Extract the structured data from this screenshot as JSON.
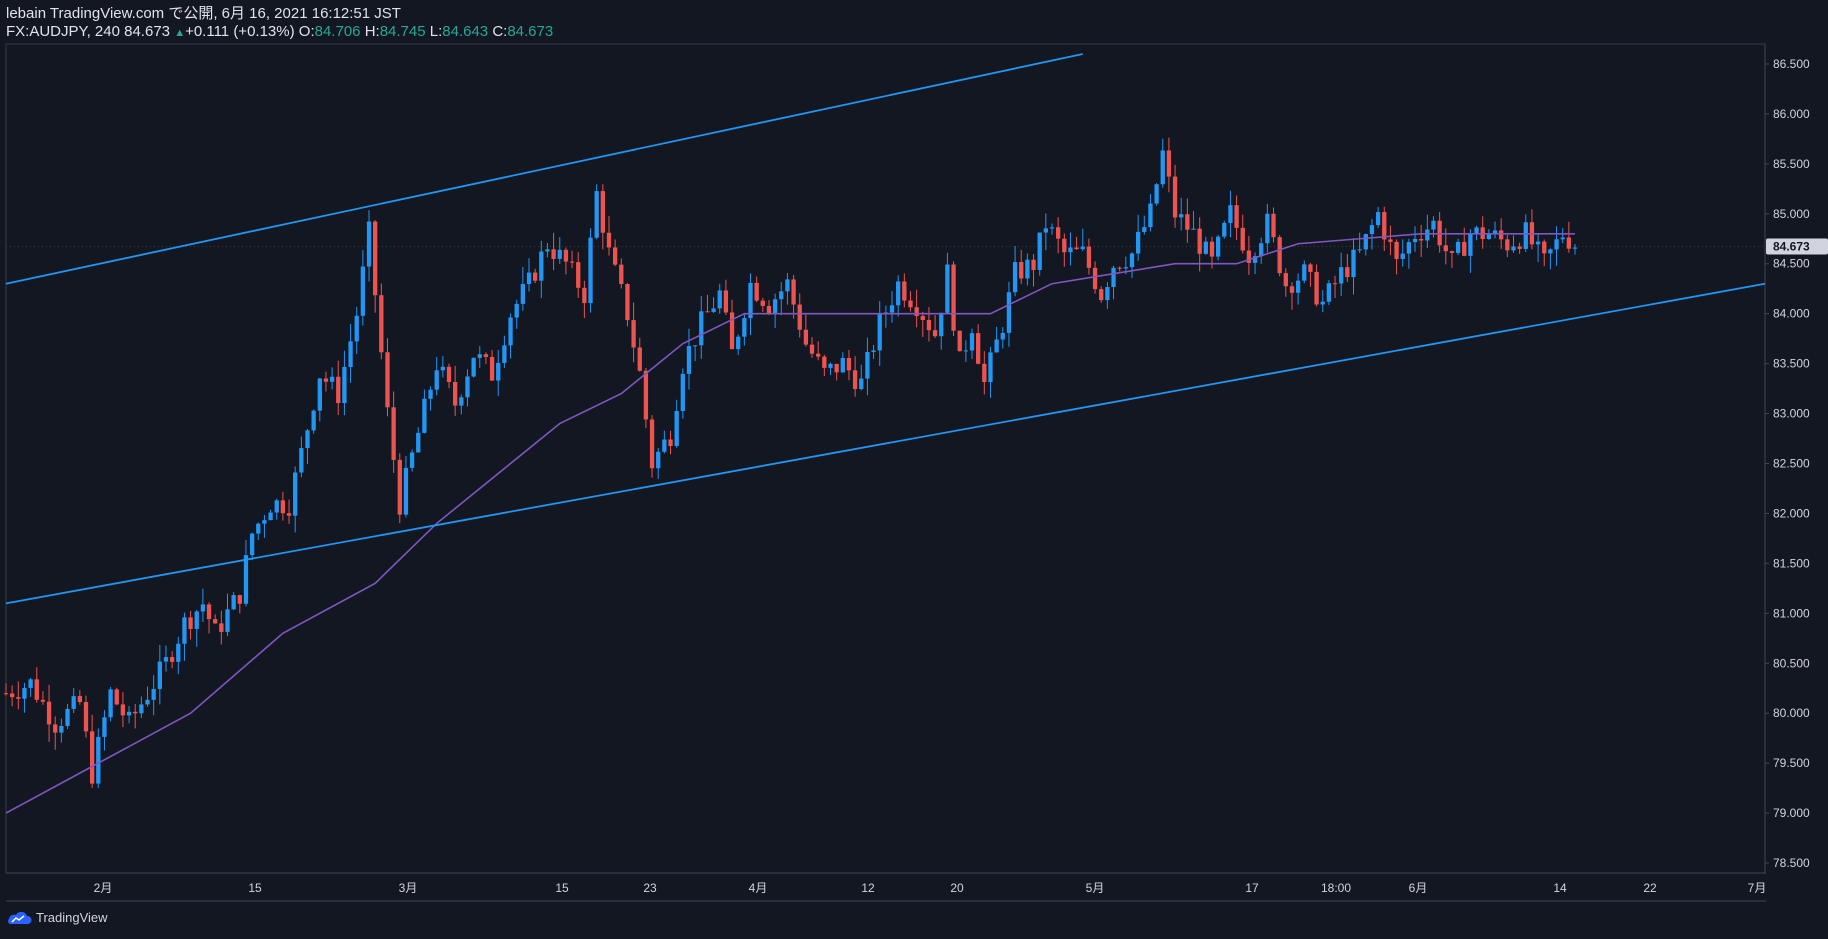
{
  "header": {
    "published_line": "lebain TradingView.com で公開, 6月 16, 2021 16:12:51 JST",
    "symbol": "FX:AUDJPY, 240",
    "last": "84.673",
    "change": "+0.111 (+0.13%)",
    "o_label": "O:",
    "o_value": "84.706",
    "h_label": "H:",
    "h_value": "84.745",
    "l_label": "L:",
    "l_value": "84.643",
    "c_label": "C:",
    "c_value": "84.673"
  },
  "brand": {
    "name": "TradingView"
  },
  "colors": {
    "background": "#131722",
    "up_candle": "#2196f3",
    "down_candle": "#ef5350",
    "moving_average": "#7e57c2",
    "trendline": "#2196f3",
    "last_price_tag": "#d1d4dc"
  },
  "chart_data": {
    "type": "candlestick",
    "title": "FX:AUDJPY, 240",
    "ylim": [
      78.4,
      86.7
    ],
    "y_ticks": [
      "86.500",
      "86.000",
      "85.500",
      "85.000",
      "84.500",
      "84.000",
      "83.500",
      "83.000",
      "82.500",
      "82.000",
      "81.500",
      "81.000",
      "80.500",
      "80.000",
      "79.500",
      "79.000",
      "78.500"
    ],
    "x_ticks": [
      "2月",
      "15",
      "3月",
      "15",
      "23",
      "4月",
      "12",
      "20",
      "5月",
      "17",
      "18:00",
      "6月",
      "14",
      "22",
      "7月"
    ],
    "last_price": "84.673",
    "price_path": [
      [
        0,
        80.2
      ],
      [
        4,
        80.3
      ],
      [
        8,
        79.9
      ],
      [
        12,
        80.1
      ],
      [
        14,
        79.4
      ],
      [
        17,
        80.2
      ],
      [
        20,
        79.9
      ],
      [
        23,
        80.2
      ],
      [
        26,
        80.5
      ],
      [
        29,
        80.9
      ],
      [
        32,
        81.1
      ],
      [
        34,
        80.8
      ],
      [
        38,
        81.2
      ],
      [
        40,
        81.8
      ],
      [
        43,
        82.1
      ],
      [
        46,
        82.1
      ],
      [
        48,
        82.6
      ],
      [
        51,
        83.4
      ],
      [
        54,
        83.2
      ],
      [
        57,
        84.0
      ],
      [
        59,
        84.8
      ],
      [
        60,
        84.2
      ],
      [
        62,
        83.0
      ],
      [
        64,
        82.1
      ],
      [
        67,
        82.8
      ],
      [
        70,
        83.5
      ],
      [
        73,
        83.1
      ],
      [
        76,
        83.6
      ],
      [
        79,
        83.4
      ],
      [
        82,
        84.0
      ],
      [
        85,
        84.3
      ],
      [
        88,
        84.7
      ],
      [
        91,
        84.5
      ],
      [
        94,
        84.2
      ],
      [
        96,
        85.2
      ],
      [
        98,
        84.6
      ],
      [
        101,
        84.0
      ],
      [
        103,
        83.4
      ],
      [
        105,
        82.5
      ],
      [
        108,
        82.8
      ],
      [
        110,
        83.5
      ],
      [
        113,
        83.9
      ],
      [
        116,
        84.2
      ],
      [
        118,
        83.6
      ],
      [
        121,
        84.3
      ],
      [
        124,
        84.1
      ],
      [
        127,
        84.3
      ],
      [
        130,
        83.7
      ],
      [
        133,
        83.4
      ],
      [
        136,
        83.5
      ],
      [
        139,
        83.3
      ],
      [
        142,
        83.9
      ],
      [
        145,
        84.3
      ],
      [
        148,
        84.1
      ],
      [
        151,
        83.8
      ],
      [
        153,
        84.4
      ],
      [
        155,
        83.5
      ],
      [
        157,
        83.9
      ],
      [
        159,
        83.3
      ],
      [
        162,
        83.9
      ],
      [
        164,
        84.4
      ],
      [
        167,
        84.5
      ],
      [
        169,
        84.9
      ],
      [
        172,
        84.6
      ],
      [
        175,
        84.6
      ],
      [
        178,
        84.2
      ],
      [
        180,
        84.5
      ],
      [
        183,
        84.6
      ],
      [
        186,
        85.0
      ],
      [
        188,
        85.6
      ],
      [
        190,
        85.0
      ],
      [
        193,
        84.8
      ],
      [
        196,
        84.5
      ],
      [
        199,
        85.0
      ],
      [
        202,
        84.6
      ],
      [
        205,
        84.9
      ],
      [
        208,
        84.3
      ],
      [
        211,
        84.4
      ],
      [
        214,
        84.1
      ],
      [
        217,
        84.4
      ],
      [
        220,
        84.6
      ],
      [
        223,
        85.0
      ],
      [
        226,
        84.5
      ],
      [
        229,
        84.8
      ],
      [
        232,
        84.9
      ],
      [
        235,
        84.5
      ],
      [
        238,
        84.8
      ],
      [
        241,
        84.8
      ],
      [
        244,
        84.7
      ],
      [
        247,
        84.8
      ],
      [
        250,
        84.5
      ],
      [
        253,
        84.8
      ],
      [
        255,
        84.7
      ]
    ],
    "moving_average": [
      [
        0,
        79.0
      ],
      [
        15,
        79.5
      ],
      [
        30,
        80.0
      ],
      [
        45,
        80.8
      ],
      [
        60,
        81.3
      ],
      [
        70,
        81.9
      ],
      [
        80,
        82.4
      ],
      [
        90,
        82.9
      ],
      [
        100,
        83.2
      ],
      [
        110,
        83.7
      ],
      [
        120,
        84.0
      ],
      [
        130,
        84.0
      ],
      [
        145,
        84.0
      ],
      [
        160,
        84.0
      ],
      [
        170,
        84.3
      ],
      [
        180,
        84.4
      ],
      [
        190,
        84.5
      ],
      [
        200,
        84.5
      ],
      [
        210,
        84.7
      ],
      [
        220,
        84.75
      ],
      [
        230,
        84.8
      ],
      [
        240,
        84.8
      ],
      [
        255,
        84.8
      ]
    ],
    "trendlines": [
      {
        "points": [
          [
            0,
            84.3
          ],
          [
            175,
            86.6
          ]
        ]
      },
      {
        "points": [
          [
            0,
            81.1
          ],
          [
            255,
            84.3
          ]
        ]
      }
    ]
  }
}
